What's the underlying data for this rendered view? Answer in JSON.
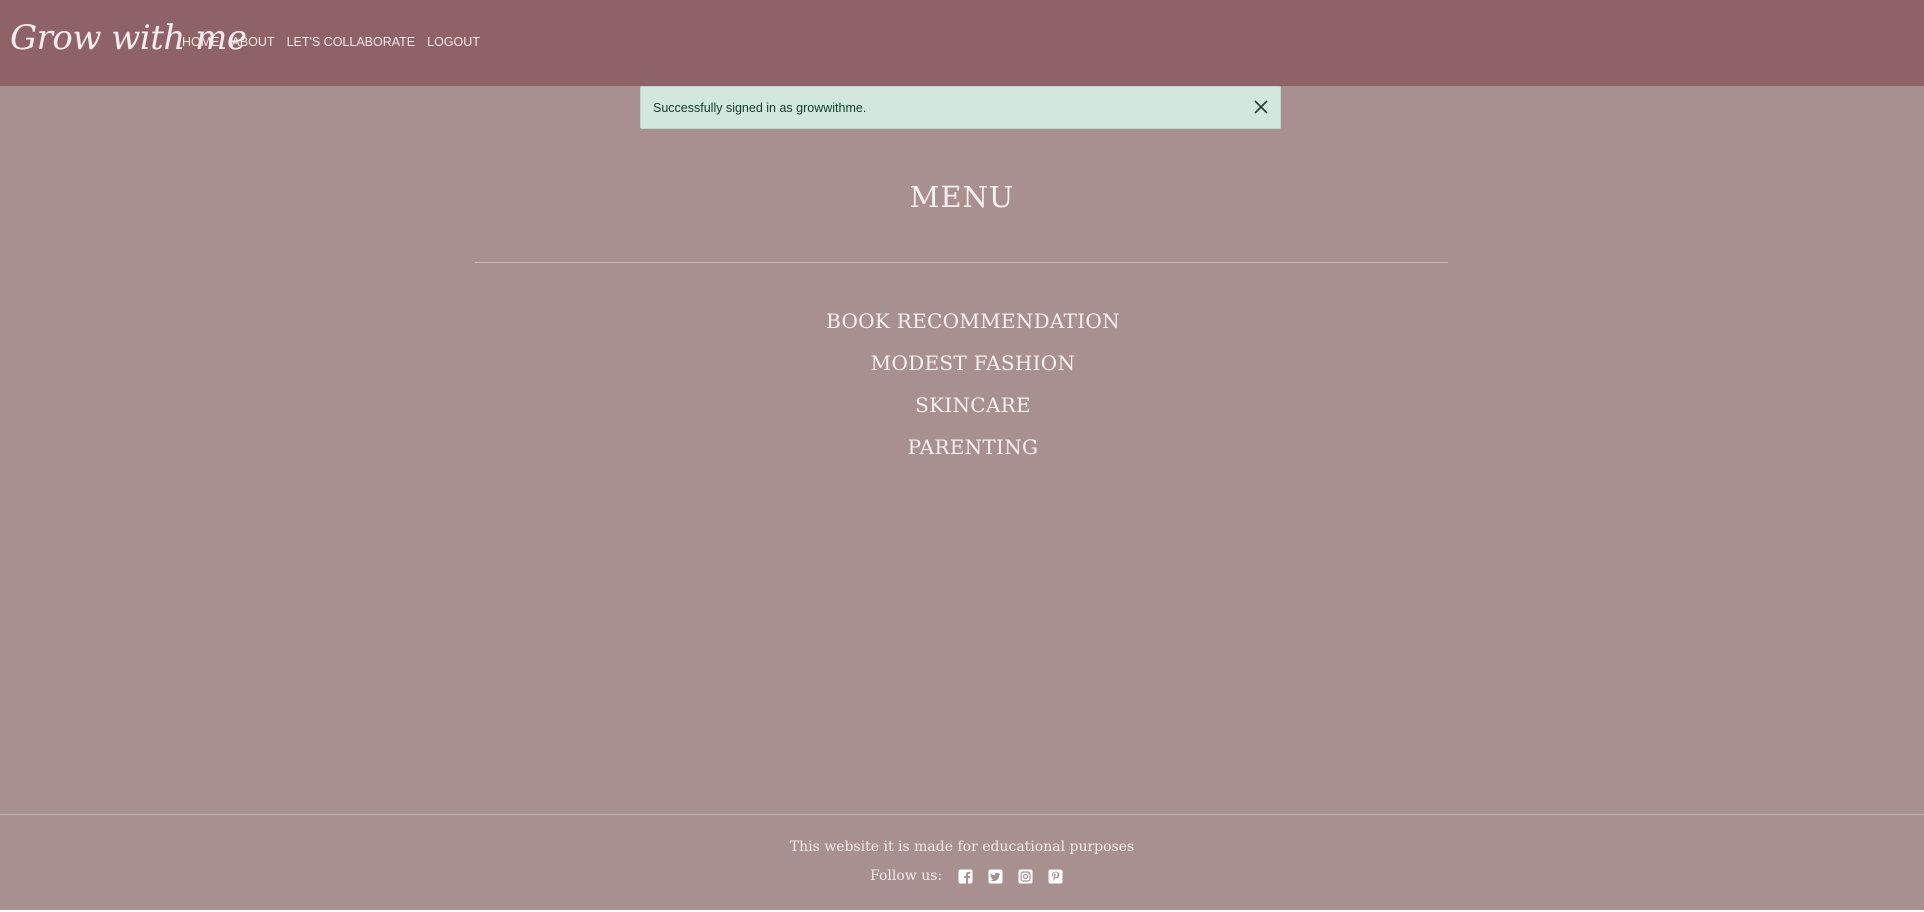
{
  "navbar": {
    "brand": "Grow with me",
    "links": [
      "HOME",
      "ABOUT",
      "LET'S COLLABORATE",
      "LOGOUT"
    ]
  },
  "alert": {
    "message": "Successfully signed in as growwithme.",
    "close_icon": "close-icon"
  },
  "menu": {
    "title": "MENU",
    "items": [
      "BOOK RECOMMENDATION",
      "MODEST FASHION",
      "SKINCARE",
      "PARENTING"
    ]
  },
  "footer": {
    "note": "This website it is made for educational purposes",
    "follow_label": "Follow us:",
    "social_icons": [
      "facebook-icon",
      "twitter-icon",
      "instagram-icon",
      "pinterest-icon"
    ]
  },
  "colors": {
    "navbar_bg": "#8e6266",
    "page_bg": "#a89090",
    "alert_bg": "#d2e7dd",
    "text_light": "#f6eeee"
  }
}
